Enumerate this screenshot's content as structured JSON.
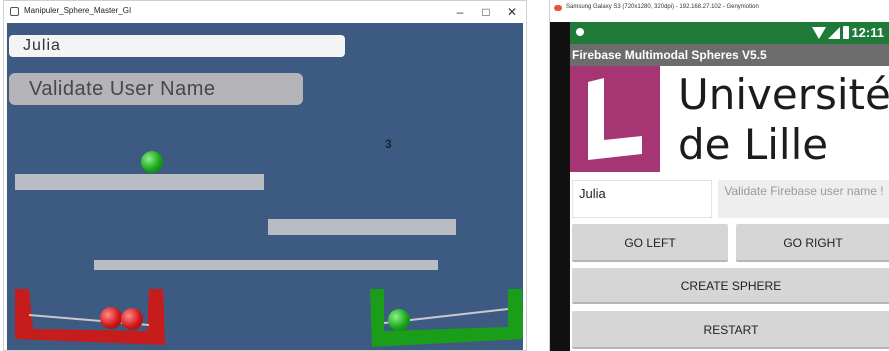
{
  "left_window": {
    "title": "Manipuler_Sphere_Master_GI",
    "controls": {
      "minimize": "–",
      "maximize": "□",
      "close": "✕"
    },
    "game": {
      "name_value": "Julia",
      "validate_label": "Validate User Name",
      "score": "3",
      "colors": {
        "background": "#3d5a82",
        "platform": "#b9bcc3",
        "red_basket": "#c61c1c",
        "green_basket": "#1a9e1a"
      }
    }
  },
  "right_window": {
    "title": "Samsung Galaxy S3 (720x1280, 320dpi) - 192.168.27.102 - Genymotion",
    "status": {
      "time": "12:11"
    },
    "app_title": "Firebase Multimodal Spheres V5.5",
    "logo": {
      "line1": "Université",
      "line2": "de Lille",
      "color": "#a63574"
    },
    "name_value": "Julia",
    "validate_label": "Validate Firebase user name !",
    "buttons": {
      "go_left": "GO LEFT",
      "go_right": "GO RIGHT",
      "create_sphere": "CREATE SPHERE",
      "restart": "RESTART"
    }
  }
}
